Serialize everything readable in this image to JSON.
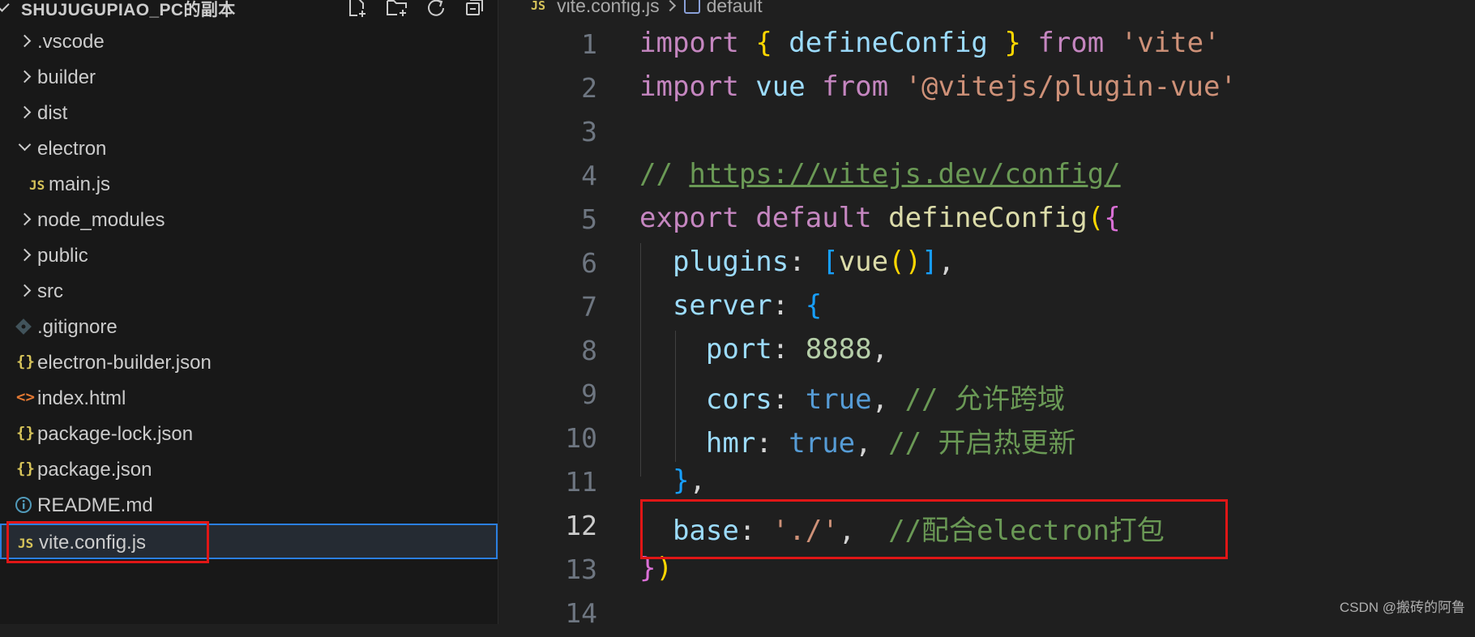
{
  "explorer": {
    "title": "SHUJUGUPIAO_PC的副本",
    "actions": [
      "new-file-icon",
      "new-folder-icon",
      "refresh-icon",
      "collapse-all-icon"
    ],
    "items": [
      {
        "label": ".vscode",
        "type": "folder",
        "expanded": false,
        "depth": 0
      },
      {
        "label": "builder",
        "type": "folder",
        "expanded": false,
        "depth": 0
      },
      {
        "label": "dist",
        "type": "folder",
        "expanded": false,
        "depth": 0
      },
      {
        "label": "electron",
        "type": "folder",
        "expanded": true,
        "depth": 0
      },
      {
        "label": "main.js",
        "type": "js",
        "icon_text": "JS",
        "depth": 1
      },
      {
        "label": "node_modules",
        "type": "folder",
        "expanded": false,
        "depth": 0
      },
      {
        "label": "public",
        "type": "folder",
        "expanded": false,
        "depth": 0
      },
      {
        "label": "src",
        "type": "folder",
        "expanded": false,
        "depth": 0
      },
      {
        "label": ".gitignore",
        "type": "git",
        "depth": 0
      },
      {
        "label": "electron-builder.json",
        "type": "json",
        "icon_text": "{}",
        "depth": 0
      },
      {
        "label": "index.html",
        "type": "html",
        "icon_text": "<>",
        "depth": 0
      },
      {
        "label": "package-lock.json",
        "type": "json",
        "icon_text": "{}",
        "depth": 0
      },
      {
        "label": "package.json",
        "type": "json",
        "icon_text": "{}",
        "depth": 0
      },
      {
        "label": "README.md",
        "type": "info",
        "depth": 0
      },
      {
        "label": "vite.config.js",
        "type": "js",
        "icon_text": "JS",
        "depth": 0,
        "selected": true
      }
    ]
  },
  "breadcrumb": {
    "file_icon_text": "JS",
    "file": "vite.config.js",
    "symbol": "default"
  },
  "editor": {
    "active_line": 12,
    "lines": [
      {
        "n": "1",
        "tokens": [
          [
            "import",
            "kw"
          ],
          [
            " ",
            "p"
          ],
          [
            "{",
            "br1"
          ],
          [
            " defineConfig ",
            "v"
          ],
          [
            "}",
            "br1"
          ],
          [
            " ",
            "p"
          ],
          [
            "from",
            "kw"
          ],
          [
            " ",
            "p"
          ],
          [
            "'vite'",
            "s"
          ]
        ]
      },
      {
        "n": "2",
        "tokens": [
          [
            "import",
            "kw"
          ],
          [
            " vue ",
            "v"
          ],
          [
            "from",
            "kw"
          ],
          [
            " ",
            "p"
          ],
          [
            "'@vitejs/plugin-vue'",
            "s"
          ]
        ]
      },
      {
        "n": "3",
        "tokens": []
      },
      {
        "n": "4",
        "tokens": [
          [
            "// ",
            "c"
          ],
          [
            "https://vitejs.dev/config/",
            "cl"
          ]
        ]
      },
      {
        "n": "5",
        "tokens": [
          [
            "export",
            "kw"
          ],
          [
            " ",
            "p"
          ],
          [
            "default",
            "kw"
          ],
          [
            " ",
            "p"
          ],
          [
            "defineConfig",
            "fn"
          ],
          [
            "(",
            "br1"
          ],
          [
            "{",
            "br2"
          ]
        ]
      },
      {
        "n": "6",
        "tokens": [
          [
            "  ",
            "p"
          ],
          [
            "plugins",
            "v"
          ],
          [
            ": ",
            "p"
          ],
          [
            "[",
            "br3"
          ],
          [
            "vue",
            "fn"
          ],
          [
            "()",
            "br1"
          ],
          [
            "]",
            "br3"
          ],
          [
            ",",
            "p"
          ]
        ]
      },
      {
        "n": "7",
        "tokens": [
          [
            "  ",
            "p"
          ],
          [
            "server",
            "v"
          ],
          [
            ": ",
            "p"
          ],
          [
            "{",
            "br3"
          ]
        ]
      },
      {
        "n": "8",
        "tokens": [
          [
            "    ",
            "p"
          ],
          [
            "port",
            "v"
          ],
          [
            ": ",
            "p"
          ],
          [
            "8888",
            "n"
          ],
          [
            ",",
            "p"
          ]
        ]
      },
      {
        "n": "9",
        "tokens": [
          [
            "    ",
            "p"
          ],
          [
            "cors",
            "v"
          ],
          [
            ": ",
            "p"
          ],
          [
            "true",
            "b"
          ],
          [
            ", ",
            "p"
          ],
          [
            "// 允许跨域",
            "c"
          ]
        ]
      },
      {
        "n": "10",
        "tokens": [
          [
            "    ",
            "p"
          ],
          [
            "hmr",
            "v"
          ],
          [
            ": ",
            "p"
          ],
          [
            "true",
            "b"
          ],
          [
            ", ",
            "p"
          ],
          [
            "// 开启热更新",
            "c"
          ]
        ]
      },
      {
        "n": "11",
        "tokens": [
          [
            "  ",
            "p"
          ],
          [
            "}",
            "br3"
          ],
          [
            ",",
            "p"
          ]
        ]
      },
      {
        "n": "12",
        "tokens": [
          [
            "  ",
            "p"
          ],
          [
            "base",
            "v"
          ],
          [
            ": ",
            "p"
          ],
          [
            "'./'",
            "s"
          ],
          [
            ",  ",
            "p"
          ],
          [
            "//配合electron打包",
            "c"
          ]
        ]
      },
      {
        "n": "13",
        "tokens": [
          [
            "}",
            "br2"
          ],
          [
            ")",
            "br1"
          ]
        ]
      },
      {
        "n": "14",
        "tokens": []
      }
    ]
  },
  "watermark": "CSDN @搬砖的阿鲁"
}
